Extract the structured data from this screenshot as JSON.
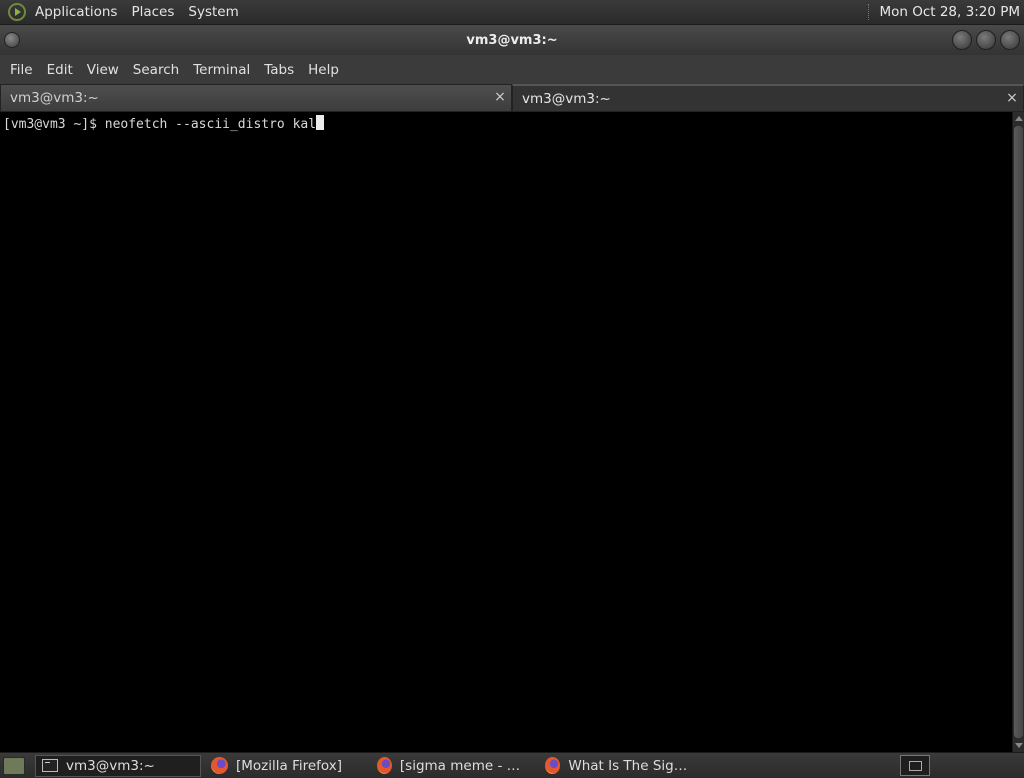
{
  "top_panel": {
    "menus": [
      "Applications",
      "Places",
      "System"
    ],
    "clock": "Mon Oct 28,  3:20 PM",
    "logo_icon": "applications-logo-icon"
  },
  "window": {
    "title": "vm3@vm3:~"
  },
  "menubar": {
    "items": [
      "File",
      "Edit",
      "View",
      "Search",
      "Terminal",
      "Tabs",
      "Help"
    ]
  },
  "tabs": [
    {
      "label": "vm3@vm3:~",
      "close": "×",
      "state": "inactive"
    },
    {
      "label": "vm3@vm3:~",
      "close": "×",
      "state": "active"
    }
  ],
  "terminal": {
    "prompt_line": "[vm3@vm3 ~]$ neofetch --ascii_distro kal"
  },
  "taskbar": {
    "tasks": [
      {
        "label": "vm3@vm3:~",
        "icon": "terminal-icon"
      },
      {
        "label": "[Mozilla Firefox]",
        "icon": "firefox-icon"
      },
      {
        "label": "[sigma meme - Goo…",
        "icon": "firefox-icon"
      },
      {
        "label": "What Is The Sigma …",
        "icon": "firefox-icon"
      }
    ]
  },
  "colors": {
    "panel_bg": "#2f2f2f",
    "terminal_bg": "#000000",
    "terminal_fg": "#d8d8d8",
    "logo_accent": "#8fb04a"
  }
}
